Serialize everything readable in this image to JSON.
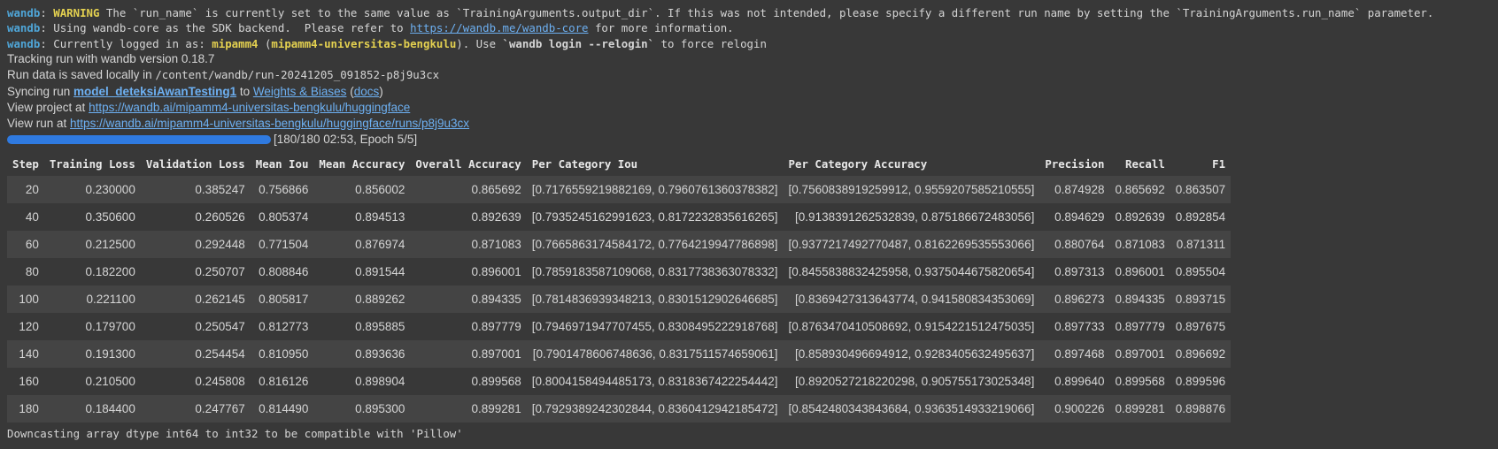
{
  "log": {
    "prefix": "wandb",
    "line1_warning": "WARNING",
    "line1_text": " The `run_name` is currently set to the same value as `TrainingArguments.output_dir`. If this was not intended, please specify a different run name by setting the `TrainingArguments.run_name` parameter.",
    "line2_text": " Using wandb-core as the SDK backend.  Please refer to ",
    "line2_link": "https://wandb.me/wandb-core",
    "line2_after": " for more information.",
    "line3_text": " Currently logged in as: ",
    "line3_user": "mipamm4",
    "line3_mid": " (",
    "line3_entity": "mipamm4-universitas-bengkulu",
    "line3_after": "). Use ",
    "line3_cmd": "`wandb login --relogin`",
    "line3_end": " to force relogin"
  },
  "tracking": {
    "version_line": "Tracking run with wandb version 0.18.7",
    "saved_text": "Run data is saved locally in ",
    "saved_path": "/content/wandb/run-20241205_091852-p8j9u3cx",
    "syncing_text": "Syncing run ",
    "run_name": "model_deteksiAwanTesting1",
    "to_text": " to ",
    "wb_link": "Weights & Biases",
    "docs_open": " (",
    "docs_link": "docs",
    "docs_close": ")",
    "project_text": "View project at ",
    "project_url": "https://wandb.ai/mipamm4-universitas-bengkulu/huggingface",
    "run_text": "View run at ",
    "run_url": "https://wandb.ai/mipamm4-universitas-bengkulu/huggingface/runs/p8j9u3cx"
  },
  "progress": {
    "fraction": 1.0,
    "label": "[180/180 02:53, Epoch 5/5]"
  },
  "table": {
    "headers": [
      "Step",
      "Training Loss",
      "Validation Loss",
      "Mean Iou",
      "Mean Accuracy",
      "Overall Accuracy",
      "Per Category Iou",
      "Per Category Accuracy",
      "Precision",
      "Recall",
      "F1"
    ],
    "rows": [
      [
        "20",
        "0.230000",
        "0.385247",
        "0.756866",
        "0.856002",
        "0.865692",
        "[0.717655921988216​9, 0.7960761360378382]",
        "[0.7560838919259912, 0.9559207585210555]",
        "0.874928",
        "0.865692",
        "0.863507"
      ],
      [
        "40",
        "0.350600",
        "0.260526",
        "0.805374",
        "0.894513",
        "0.892639",
        "[0.7935245162991623, 0.8172232835616265]",
        "[0.9138391262532839, 0.875186672483056]",
        "0.894629",
        "0.892639",
        "0.892854"
      ],
      [
        "60",
        "0.212500",
        "0.292448",
        "0.771504",
        "0.876974",
        "0.871083",
        "[0.7665863174584172, 0.7764219947786898]",
        "[0.9377217492770487, 0.8162269535553066]",
        "0.880764",
        "0.871083",
        "0.871311"
      ],
      [
        "80",
        "0.182200",
        "0.250707",
        "0.808846",
        "0.891544",
        "0.896001",
        "[0.7859183587109068, 0.8317738363078332]",
        "[0.8455838832425958, 0.9375044675820654]",
        "0.897313",
        "0.896001",
        "0.895504"
      ],
      [
        "100",
        "0.221100",
        "0.262145",
        "0.805817",
        "0.889262",
        "0.894335",
        "[0.7814836939348213, 0.8301512902646685]",
        "[0.8369427313643774, 0.941580834353069]",
        "0.896273",
        "0.894335",
        "0.893715"
      ],
      [
        "120",
        "0.179700",
        "0.250547",
        "0.812773",
        "0.895885",
        "0.897779",
        "[0.7946971947707455, 0.8308495222918768]",
        "[0.8763470410508692, 0.9154221512475035]",
        "0.897733",
        "0.897779",
        "0.897675"
      ],
      [
        "140",
        "0.191300",
        "0.254454",
        "0.810950",
        "0.893636",
        "0.897001",
        "[0.7901478606748636, 0.8317511574659061]",
        "[0.858930496694912, 0.9283405632495637]",
        "0.897468",
        "0.897001",
        "0.896692"
      ],
      [
        "160",
        "0.210500",
        "0.245808",
        "0.816126",
        "0.898904",
        "0.899568",
        "[0.8004158494485173, 0.8318367422254442]",
        "[0.8920527218220298, 0.905755173025348]",
        "0.899640",
        "0.899568",
        "0.899596"
      ],
      [
        "180",
        "0.184400",
        "0.247767",
        "0.814490",
        "0.895300",
        "0.899281",
        "[0.7929389242302844, 0.8360412942185472]",
        "[0.8542480343843684, 0.9363514933219066]",
        "0.900226",
        "0.899281",
        "0.898876"
      ]
    ]
  },
  "footer": "Downcasting array dtype int64 to int32 to be compatible with 'Pillow'"
}
